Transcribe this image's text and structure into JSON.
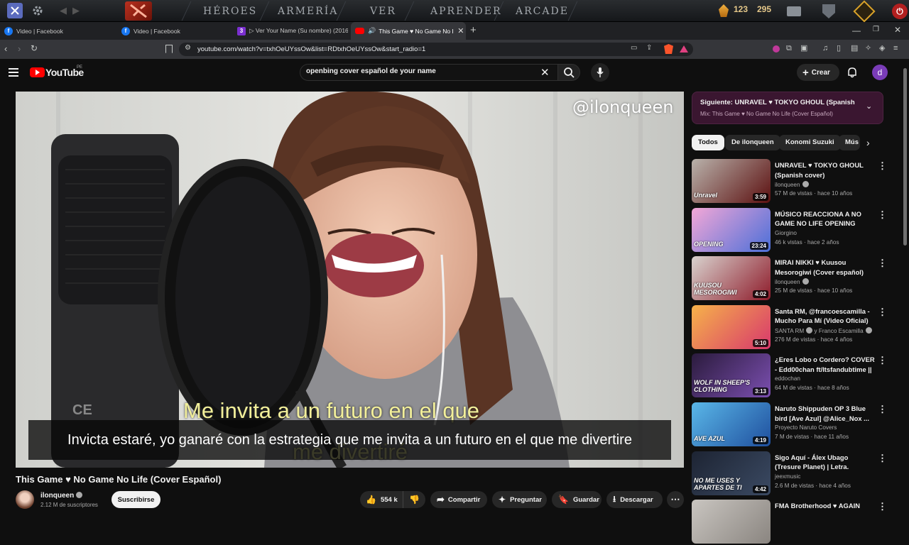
{
  "game_bar": {
    "nav": [
      "HÉROES",
      "ARMERÍA",
      "VER",
      "APRENDER",
      "ARCADE"
    ],
    "resource_a": "123",
    "resource_b": "295"
  },
  "browser": {
    "tabs": [
      {
        "label": "Video | Facebook",
        "favicon": "facebook-icon"
      },
      {
        "label": "Video | Facebook",
        "favicon": "facebook-icon"
      },
      {
        "label": "▷ Ver Your Name (Su nombre) (2016",
        "favicon": "anime-site-icon"
      },
      {
        "label": "This Game ♥ No Game No Lif",
        "favicon": "youtube-icon",
        "active": true
      }
    ],
    "new_tab": "+",
    "url": "youtube.com/watch?v=txhOeUYssOw&list=RDtxhOeUYssOw&start_radio=1"
  },
  "youtube": {
    "logo": "YouTube",
    "region": "PE",
    "search_value": "openbing cover español de your name",
    "create_label": "Crear",
    "avatar_letter": "d"
  },
  "video": {
    "watermark": "@ilonqueen",
    "burned_lyric": "Me invita a un futuro en el que",
    "burned_lyric_2": "me divertiré",
    "subtitle": "Invicta estaré, yo ganaré con la estrategia que me invita a un futuro en el que me divertire",
    "title": "This Game ♥ No Game No Life (Cover Español)",
    "channel": "ilonqueen",
    "subscribers": "2.12 M de suscriptores",
    "subscribe_label": "Suscribirse",
    "likes": "554 k",
    "share_label": "Compartir",
    "ask_label": "Preguntar",
    "save_label": "Guardar",
    "download_label": "Descargar"
  },
  "mix": {
    "next": "Siguiente: UNRAVEL ♥ TOKYO GHOUL (Spanish cov...",
    "subtitle": "Mix: This Game ♥ No Game No Life (Cover Español)"
  },
  "chips": [
    "Todos",
    "De ilonqueen",
    "Konomi Suzuki",
    "Mús"
  ],
  "related": [
    {
      "title": "UNRAVEL ♥ TOKYO GHOUL (Spanish cover)",
      "channel": "ilonqueen",
      "verified": true,
      "meta": "57 M de vistas · hace 10 años",
      "duration": "3:59",
      "thumb_text": "Unravel",
      "thumb_colors": [
        "#b9b2ab",
        "#5c1010"
      ]
    },
    {
      "title": "MÚSICO REACCIONA A NO GAME NO LIFE OPENING FULL...",
      "channel": "Giorgino",
      "verified": false,
      "meta": "46 k vistas · hace 2 años",
      "duration": "23:24",
      "thumb_text": "OPENING",
      "thumb_colors": [
        "#f3a7d7",
        "#4b6fd8"
      ]
    },
    {
      "title": "MIRAI NIKKI ♥ Kuusou Mesorogiwi (Cover español)",
      "channel": "ilonqueen",
      "verified": true,
      "meta": "25 M de vistas · hace 10 años",
      "duration": "4:02",
      "thumb_text": "KUUSOU MESOROGIWI",
      "thumb_colors": [
        "#d9d3cf",
        "#8e1b2a"
      ]
    },
    {
      "title": "Santa RM, @francoescamilla - Mucho Para Mí (Video Oficial)",
      "channel": "SANTA RM",
      "channel_2": "y Franco Escamilla",
      "verified": true,
      "meta": "276 M de vistas · hace 4 años",
      "duration": "5:10",
      "thumb_text": "",
      "thumb_colors": [
        "#f6b24a",
        "#d8386c"
      ]
    },
    {
      "title": "¿Eres Lobo o Cordero? COVER - Edd00chan ft/Itsfandubtime || ...",
      "channel": "eddochan",
      "verified": false,
      "meta": "64 M de vistas · hace 8 años",
      "duration": "3:13",
      "thumb_text": "WOLF IN SHEEP'S CLOTHING",
      "thumb_colors": [
        "#2b1b3d",
        "#7b4fb0"
      ]
    },
    {
      "title": "Naruto Shippuden OP 3 Blue bird [Ave Azul] @Alice_Nox ...",
      "channel": "Proyecto Naruto Covers",
      "verified": false,
      "meta": "7 M de vistas · hace 11 años",
      "duration": "4:19",
      "thumb_text": "AVE AZUL",
      "thumb_colors": [
        "#5ab7e8",
        "#1f4f9e"
      ]
    },
    {
      "title": "Sigo Aquí - Álex Ubago (Tresure Planet) | Letra.",
      "channel": "jeexmusic",
      "verified": false,
      "meta": "2.6 M de vistas · hace 4 años",
      "duration": "4:42",
      "thumb_text": "NO ME USES Y APARTES DE TI",
      "thumb_colors": [
        "#1d2433",
        "#3b4a63"
      ]
    },
    {
      "title": "FMA Brotherhood ♥ AGAIN",
      "channel": "",
      "verified": false,
      "meta": "",
      "duration": "",
      "thumb_text": "",
      "thumb_colors": [
        "#c9c5c0",
        "#8a8580"
      ]
    }
  ],
  "colors": {
    "yt_red": "#ff0000",
    "accent_purple": "#7a3cb8",
    "gold": "#e0a020"
  }
}
